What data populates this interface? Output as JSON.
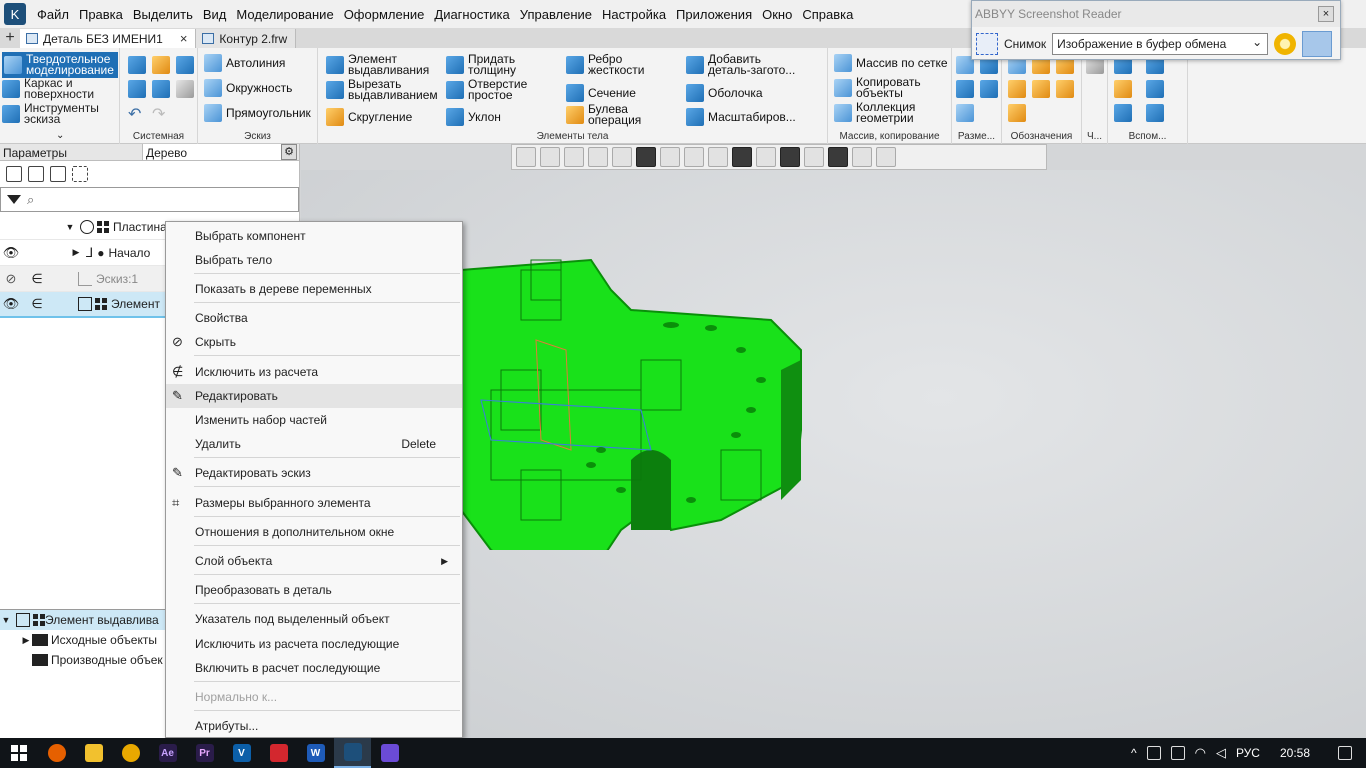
{
  "menubar": {
    "items": [
      "Файл",
      "Правка",
      "Выделить",
      "Вид",
      "Моделирование",
      "Оформление",
      "Диагностика",
      "Управление",
      "Настройка",
      "Приложения",
      "Окно",
      "Справка"
    ]
  },
  "tabs": [
    {
      "label": "Деталь БЕЗ ИМЕНИ1",
      "close": "×"
    },
    {
      "label": "Контур 2.frw"
    }
  ],
  "ribbon": {
    "modes": [
      "Твердотельное моделирование",
      "Каркас и поверхности",
      "Инструменты эскиза"
    ],
    "groups": {
      "system": "Системная",
      "sketch": "Эскиз",
      "body": "Элементы тела",
      "array": "Массив, копирование",
      "dims": "Разме...",
      "notes": "Обозначения",
      "ch": "Ч...",
      "aux": "Вспом..."
    },
    "sketch_buttons": [
      "Автолиния",
      "Окружность",
      "Прямоугольник"
    ],
    "body_buttons": [
      "Элемент выдавливания",
      "Придать толщину",
      "Ребро жесткости",
      "Добавить деталь-загото...",
      "Вырезать выдавливанием",
      "Отверстие простое",
      "Сечение",
      "Оболочка",
      "Скругление",
      "Уклон",
      "Булева операция",
      "Масштабиров..."
    ],
    "array_buttons": [
      "Массив по сетке",
      "Копировать объекты",
      "Коллекция геометрии"
    ]
  },
  "abbyy": {
    "title": "ABBYY Screenshot Reader",
    "close": "×",
    "snapshot_label": "Снимок",
    "target_value": "Изображение в буфер обмена"
  },
  "panel": {
    "tab_params": "Параметры",
    "tab_tree": "Дерево",
    "settings": "⚙",
    "search_icon": "⌕"
  },
  "tree": [
    {
      "label": "Пластина"
    },
    {
      "label": "Начало"
    },
    {
      "label": "Эскиз:1"
    },
    {
      "label": "Элемент"
    }
  ],
  "bottom_tree": [
    {
      "label": "Элемент выдавлива"
    },
    {
      "label": "Исходные объекты"
    },
    {
      "label": "Производные объек"
    }
  ],
  "context_menu": {
    "items": [
      {
        "label": "Выбрать компонент"
      },
      {
        "label": "Выбрать тело"
      },
      {
        "label": "Показать в дереве переменных"
      },
      {
        "label": "Свойства"
      },
      {
        "label": "Скрыть"
      },
      {
        "label": "Исключить из расчета"
      },
      {
        "label": "Редактировать"
      },
      {
        "label": "Изменить набор частей"
      },
      {
        "label": "Удалить",
        "shortcut": "Delete"
      },
      {
        "label": "Редактировать эскиз"
      },
      {
        "label": "Размеры выбранного элемента"
      },
      {
        "label": "Отношения в дополнительном окне"
      },
      {
        "label": "Слой объекта",
        "submenu": "▶"
      },
      {
        "label": "Преобразовать в деталь"
      },
      {
        "label": "Указатель под выделенный объект"
      },
      {
        "label": "Исключить из расчета последующие"
      },
      {
        "label": "Включить в расчет последующие"
      },
      {
        "label": "Нормально к..."
      },
      {
        "label": "Атрибуты..."
      }
    ]
  },
  "taskbar": {
    "lang": "РУС",
    "time": "20:58",
    "apps": [
      "Ae",
      "Pr",
      "V",
      "W"
    ]
  },
  "colors": {
    "accent": "#1f6fb5",
    "model_fill": "#19e11a",
    "model_edge": "#0a8f0a",
    "selection": "#cde8f6"
  }
}
